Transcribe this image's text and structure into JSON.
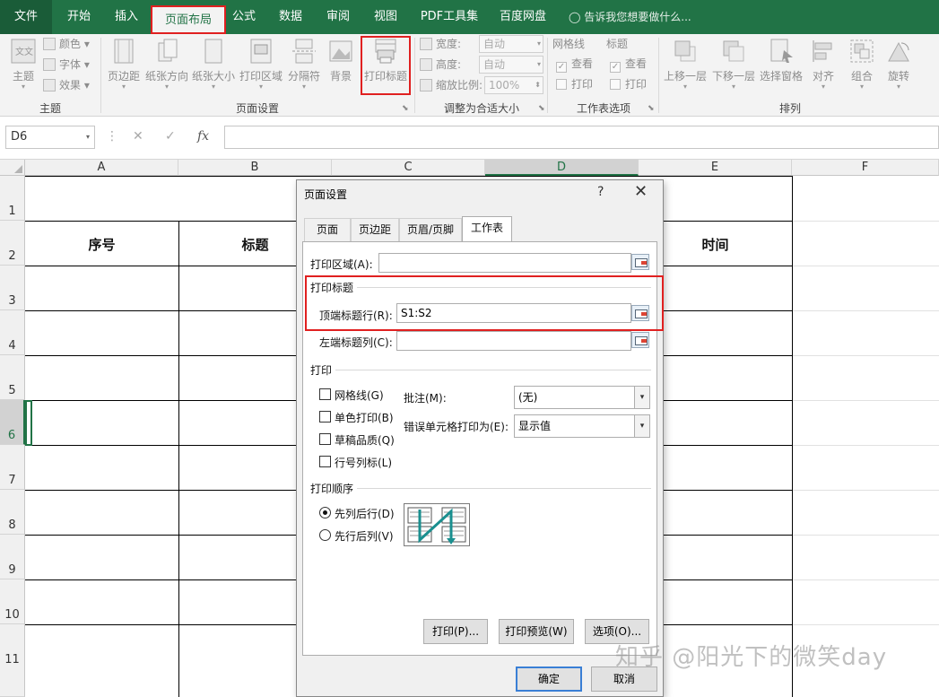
{
  "ribbon_tabs": [
    {
      "label": "文件"
    },
    {
      "label": "开始"
    },
    {
      "label": "插入"
    },
    {
      "label": "页面布局"
    },
    {
      "label": "公式"
    },
    {
      "label": "数据"
    },
    {
      "label": "审阅"
    },
    {
      "label": "视图"
    },
    {
      "label": "PDF工具集"
    },
    {
      "label": "百度网盘"
    }
  ],
  "tell_me": "告诉我您想要做什么...",
  "ribbon": {
    "theme_group": {
      "label": "主题",
      "themes": "主题",
      "colors": "颜色",
      "fonts": "字体",
      "effects": "效果"
    },
    "page_setup_group": {
      "label": "页面设置",
      "margins": "页边距",
      "orientation": "纸张方向",
      "size": "纸张大小",
      "print_area": "打印区域",
      "breaks": "分隔符",
      "background": "背景",
      "print_titles": "打印标题"
    },
    "scale_group": {
      "label": "调整为合适大小",
      "width_label": "宽度:",
      "width_value": "自动",
      "height_label": "高度:",
      "height_value": "自动",
      "scale_label": "缩放比例:",
      "scale_value": "100%"
    },
    "sheet_options_group": {
      "label": "工作表选项",
      "gridlines": "网格线",
      "headings": "标题",
      "view": "查看",
      "print": "打印"
    },
    "arrange_group": {
      "label": "排列",
      "bring_forward": "上移一层",
      "send_backward": "下移一层",
      "selection_pane": "选择窗格",
      "align": "对齐",
      "group": "组合",
      "rotate": "旋转"
    }
  },
  "formula_bar": {
    "name_box": "D6",
    "fx": "fx"
  },
  "sheet": {
    "columns": [
      "A",
      "B",
      "C",
      "D",
      "E",
      "F"
    ],
    "rows": [
      "1",
      "2",
      "3",
      "4",
      "5",
      "6",
      "7",
      "8",
      "9",
      "10",
      "11"
    ],
    "headers": {
      "a2": "序号",
      "b2": "标题",
      "e2": "时间"
    }
  },
  "dialog": {
    "title": "页面设置",
    "help": "?",
    "close": "✕",
    "tabs": [
      {
        "label": "页面"
      },
      {
        "label": "页边距"
      },
      {
        "label": "页眉/页脚"
      },
      {
        "label": "工作表"
      }
    ],
    "print_area_label": "打印区域(A):",
    "print_area_value": "",
    "print_titles_section": "打印标题",
    "rows_to_repeat_label": "顶端标题行(R):",
    "rows_to_repeat_value": "S1:S2",
    "cols_to_repeat_label": "左端标题列(C):",
    "cols_to_repeat_value": "",
    "print_section": "打印",
    "print_options": [
      {
        "label": "网格线(G)",
        "checked": false
      },
      {
        "label": "单色打印(B)",
        "checked": false
      },
      {
        "label": "草稿品质(Q)",
        "checked": false
      },
      {
        "label": "行号列标(L)",
        "checked": false
      }
    ],
    "comments_label": "批注(M):",
    "comments_value": "(无)",
    "errors_label": "错误单元格打印为(E):",
    "errors_value": "显示值",
    "order_section": "打印顺序",
    "order_options": [
      {
        "label": "先列后行(D)",
        "selected": true
      },
      {
        "label": "先行后列(V)",
        "selected": false
      }
    ],
    "buttons": {
      "print": "打印(P)...",
      "preview": "打印预览(W)",
      "options": "选项(O)...",
      "ok": "确定",
      "cancel": "取消"
    }
  },
  "watermark": "知乎 @阳光下的微笑day",
  "colors": {
    "excel_green": "#217346",
    "highlight_red": "#e02020"
  }
}
